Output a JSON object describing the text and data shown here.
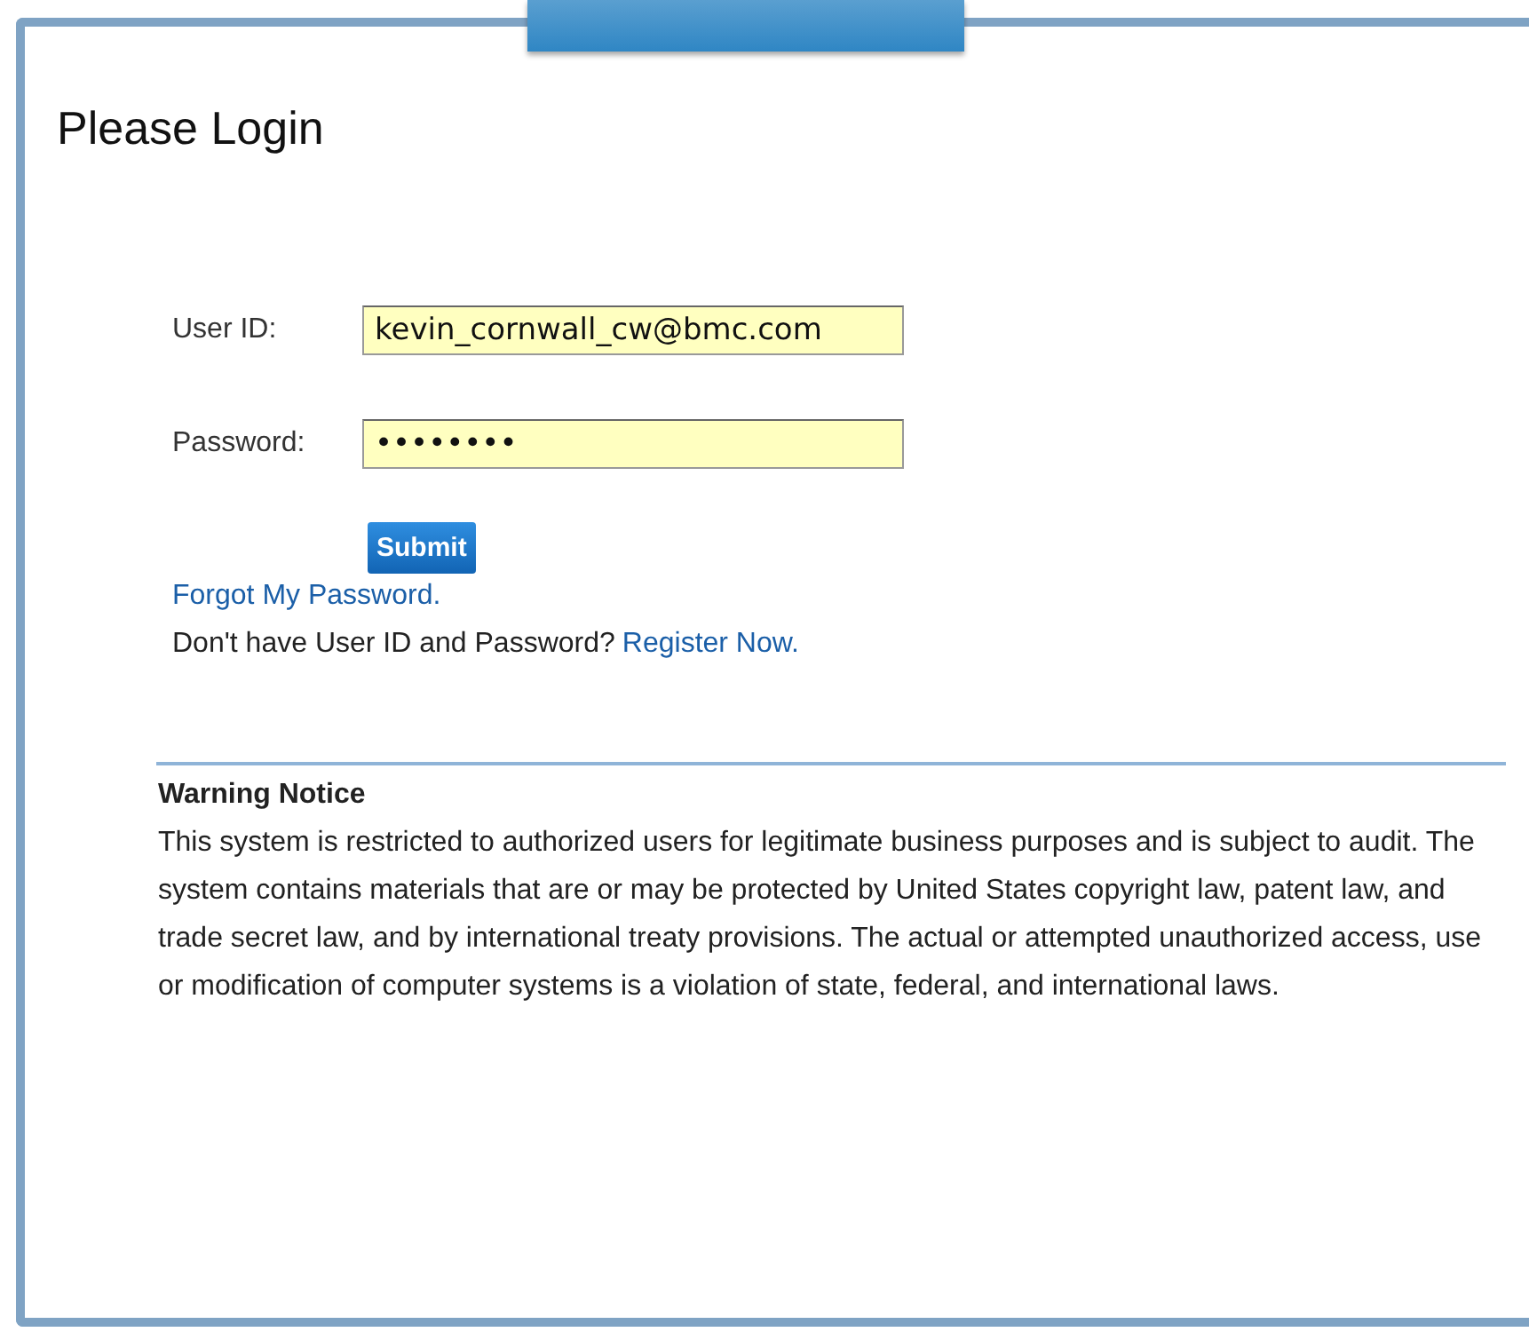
{
  "title": "Please Login",
  "fields": [
    {
      "label": "User ID:",
      "value": "kevin_cornwall_cw@bmc.com"
    },
    {
      "label": "Password:",
      "value": "••••••••"
    }
  ],
  "submit": "Submit",
  "forgot_link": "Forgot My Password.",
  "register": {
    "prompt": "Don't have User ID and Password?",
    "link": "Register Now."
  },
  "notice": {
    "heading": "Warning Notice",
    "text": "This system is restricted to authorized users for legitimate business purposes and is subject to audit. The system contains materials that are or may be protected by United States copyright law, patent law, and trade secret law, and by international treaty provisions. The actual or attempted unauthorized access, use or modification of computer systems is a violation of state, federal, and international laws."
  }
}
